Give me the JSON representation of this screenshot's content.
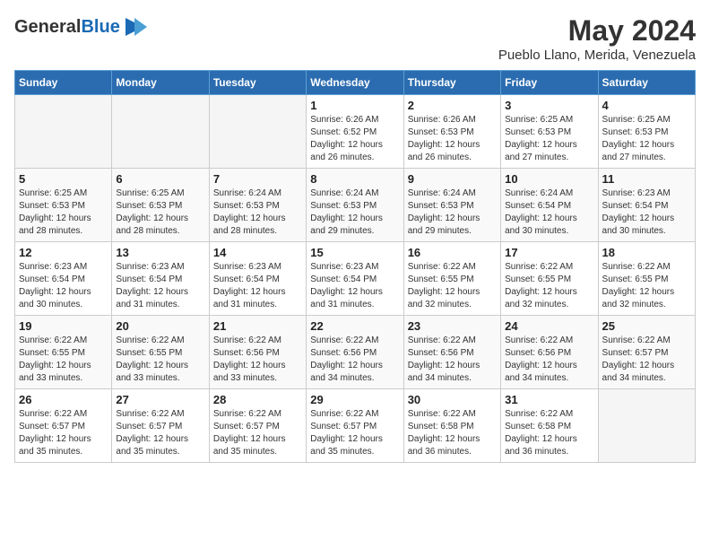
{
  "logo": {
    "general": "General",
    "blue": "Blue"
  },
  "title": {
    "month_year": "May 2024",
    "location": "Pueblo Llano, Merida, Venezuela"
  },
  "headers": [
    "Sunday",
    "Monday",
    "Tuesday",
    "Wednesday",
    "Thursday",
    "Friday",
    "Saturday"
  ],
  "weeks": [
    [
      {
        "day": "",
        "sunrise": "",
        "sunset": "",
        "daylight": ""
      },
      {
        "day": "",
        "sunrise": "",
        "sunset": "",
        "daylight": ""
      },
      {
        "day": "",
        "sunrise": "",
        "sunset": "",
        "daylight": ""
      },
      {
        "day": "1",
        "sunrise": "Sunrise: 6:26 AM",
        "sunset": "Sunset: 6:52 PM",
        "daylight": "Daylight: 12 hours and 26 minutes."
      },
      {
        "day": "2",
        "sunrise": "Sunrise: 6:26 AM",
        "sunset": "Sunset: 6:53 PM",
        "daylight": "Daylight: 12 hours and 26 minutes."
      },
      {
        "day": "3",
        "sunrise": "Sunrise: 6:25 AM",
        "sunset": "Sunset: 6:53 PM",
        "daylight": "Daylight: 12 hours and 27 minutes."
      },
      {
        "day": "4",
        "sunrise": "Sunrise: 6:25 AM",
        "sunset": "Sunset: 6:53 PM",
        "daylight": "Daylight: 12 hours and 27 minutes."
      }
    ],
    [
      {
        "day": "5",
        "sunrise": "Sunrise: 6:25 AM",
        "sunset": "Sunset: 6:53 PM",
        "daylight": "Daylight: 12 hours and 28 minutes."
      },
      {
        "day": "6",
        "sunrise": "Sunrise: 6:25 AM",
        "sunset": "Sunset: 6:53 PM",
        "daylight": "Daylight: 12 hours and 28 minutes."
      },
      {
        "day": "7",
        "sunrise": "Sunrise: 6:24 AM",
        "sunset": "Sunset: 6:53 PM",
        "daylight": "Daylight: 12 hours and 28 minutes."
      },
      {
        "day": "8",
        "sunrise": "Sunrise: 6:24 AM",
        "sunset": "Sunset: 6:53 PM",
        "daylight": "Daylight: 12 hours and 29 minutes."
      },
      {
        "day": "9",
        "sunrise": "Sunrise: 6:24 AM",
        "sunset": "Sunset: 6:53 PM",
        "daylight": "Daylight: 12 hours and 29 minutes."
      },
      {
        "day": "10",
        "sunrise": "Sunrise: 6:24 AM",
        "sunset": "Sunset: 6:54 PM",
        "daylight": "Daylight: 12 hours and 30 minutes."
      },
      {
        "day": "11",
        "sunrise": "Sunrise: 6:23 AM",
        "sunset": "Sunset: 6:54 PM",
        "daylight": "Daylight: 12 hours and 30 minutes."
      }
    ],
    [
      {
        "day": "12",
        "sunrise": "Sunrise: 6:23 AM",
        "sunset": "Sunset: 6:54 PM",
        "daylight": "Daylight: 12 hours and 30 minutes."
      },
      {
        "day": "13",
        "sunrise": "Sunrise: 6:23 AM",
        "sunset": "Sunset: 6:54 PM",
        "daylight": "Daylight: 12 hours and 31 minutes."
      },
      {
        "day": "14",
        "sunrise": "Sunrise: 6:23 AM",
        "sunset": "Sunset: 6:54 PM",
        "daylight": "Daylight: 12 hours and 31 minutes."
      },
      {
        "day": "15",
        "sunrise": "Sunrise: 6:23 AM",
        "sunset": "Sunset: 6:54 PM",
        "daylight": "Daylight: 12 hours and 31 minutes."
      },
      {
        "day": "16",
        "sunrise": "Sunrise: 6:22 AM",
        "sunset": "Sunset: 6:55 PM",
        "daylight": "Daylight: 12 hours and 32 minutes."
      },
      {
        "day": "17",
        "sunrise": "Sunrise: 6:22 AM",
        "sunset": "Sunset: 6:55 PM",
        "daylight": "Daylight: 12 hours and 32 minutes."
      },
      {
        "day": "18",
        "sunrise": "Sunrise: 6:22 AM",
        "sunset": "Sunset: 6:55 PM",
        "daylight": "Daylight: 12 hours and 32 minutes."
      }
    ],
    [
      {
        "day": "19",
        "sunrise": "Sunrise: 6:22 AM",
        "sunset": "Sunset: 6:55 PM",
        "daylight": "Daylight: 12 hours and 33 minutes."
      },
      {
        "day": "20",
        "sunrise": "Sunrise: 6:22 AM",
        "sunset": "Sunset: 6:55 PM",
        "daylight": "Daylight: 12 hours and 33 minutes."
      },
      {
        "day": "21",
        "sunrise": "Sunrise: 6:22 AM",
        "sunset": "Sunset: 6:56 PM",
        "daylight": "Daylight: 12 hours and 33 minutes."
      },
      {
        "day": "22",
        "sunrise": "Sunrise: 6:22 AM",
        "sunset": "Sunset: 6:56 PM",
        "daylight": "Daylight: 12 hours and 34 minutes."
      },
      {
        "day": "23",
        "sunrise": "Sunrise: 6:22 AM",
        "sunset": "Sunset: 6:56 PM",
        "daylight": "Daylight: 12 hours and 34 minutes."
      },
      {
        "day": "24",
        "sunrise": "Sunrise: 6:22 AM",
        "sunset": "Sunset: 6:56 PM",
        "daylight": "Daylight: 12 hours and 34 minutes."
      },
      {
        "day": "25",
        "sunrise": "Sunrise: 6:22 AM",
        "sunset": "Sunset: 6:57 PM",
        "daylight": "Daylight: 12 hours and 34 minutes."
      }
    ],
    [
      {
        "day": "26",
        "sunrise": "Sunrise: 6:22 AM",
        "sunset": "Sunset: 6:57 PM",
        "daylight": "Daylight: 12 hours and 35 minutes."
      },
      {
        "day": "27",
        "sunrise": "Sunrise: 6:22 AM",
        "sunset": "Sunset: 6:57 PM",
        "daylight": "Daylight: 12 hours and 35 minutes."
      },
      {
        "day": "28",
        "sunrise": "Sunrise: 6:22 AM",
        "sunset": "Sunset: 6:57 PM",
        "daylight": "Daylight: 12 hours and 35 minutes."
      },
      {
        "day": "29",
        "sunrise": "Sunrise: 6:22 AM",
        "sunset": "Sunset: 6:57 PM",
        "daylight": "Daylight: 12 hours and 35 minutes."
      },
      {
        "day": "30",
        "sunrise": "Sunrise: 6:22 AM",
        "sunset": "Sunset: 6:58 PM",
        "daylight": "Daylight: 12 hours and 36 minutes."
      },
      {
        "day": "31",
        "sunrise": "Sunrise: 6:22 AM",
        "sunset": "Sunset: 6:58 PM",
        "daylight": "Daylight: 12 hours and 36 minutes."
      },
      {
        "day": "",
        "sunrise": "",
        "sunset": "",
        "daylight": ""
      }
    ]
  ]
}
